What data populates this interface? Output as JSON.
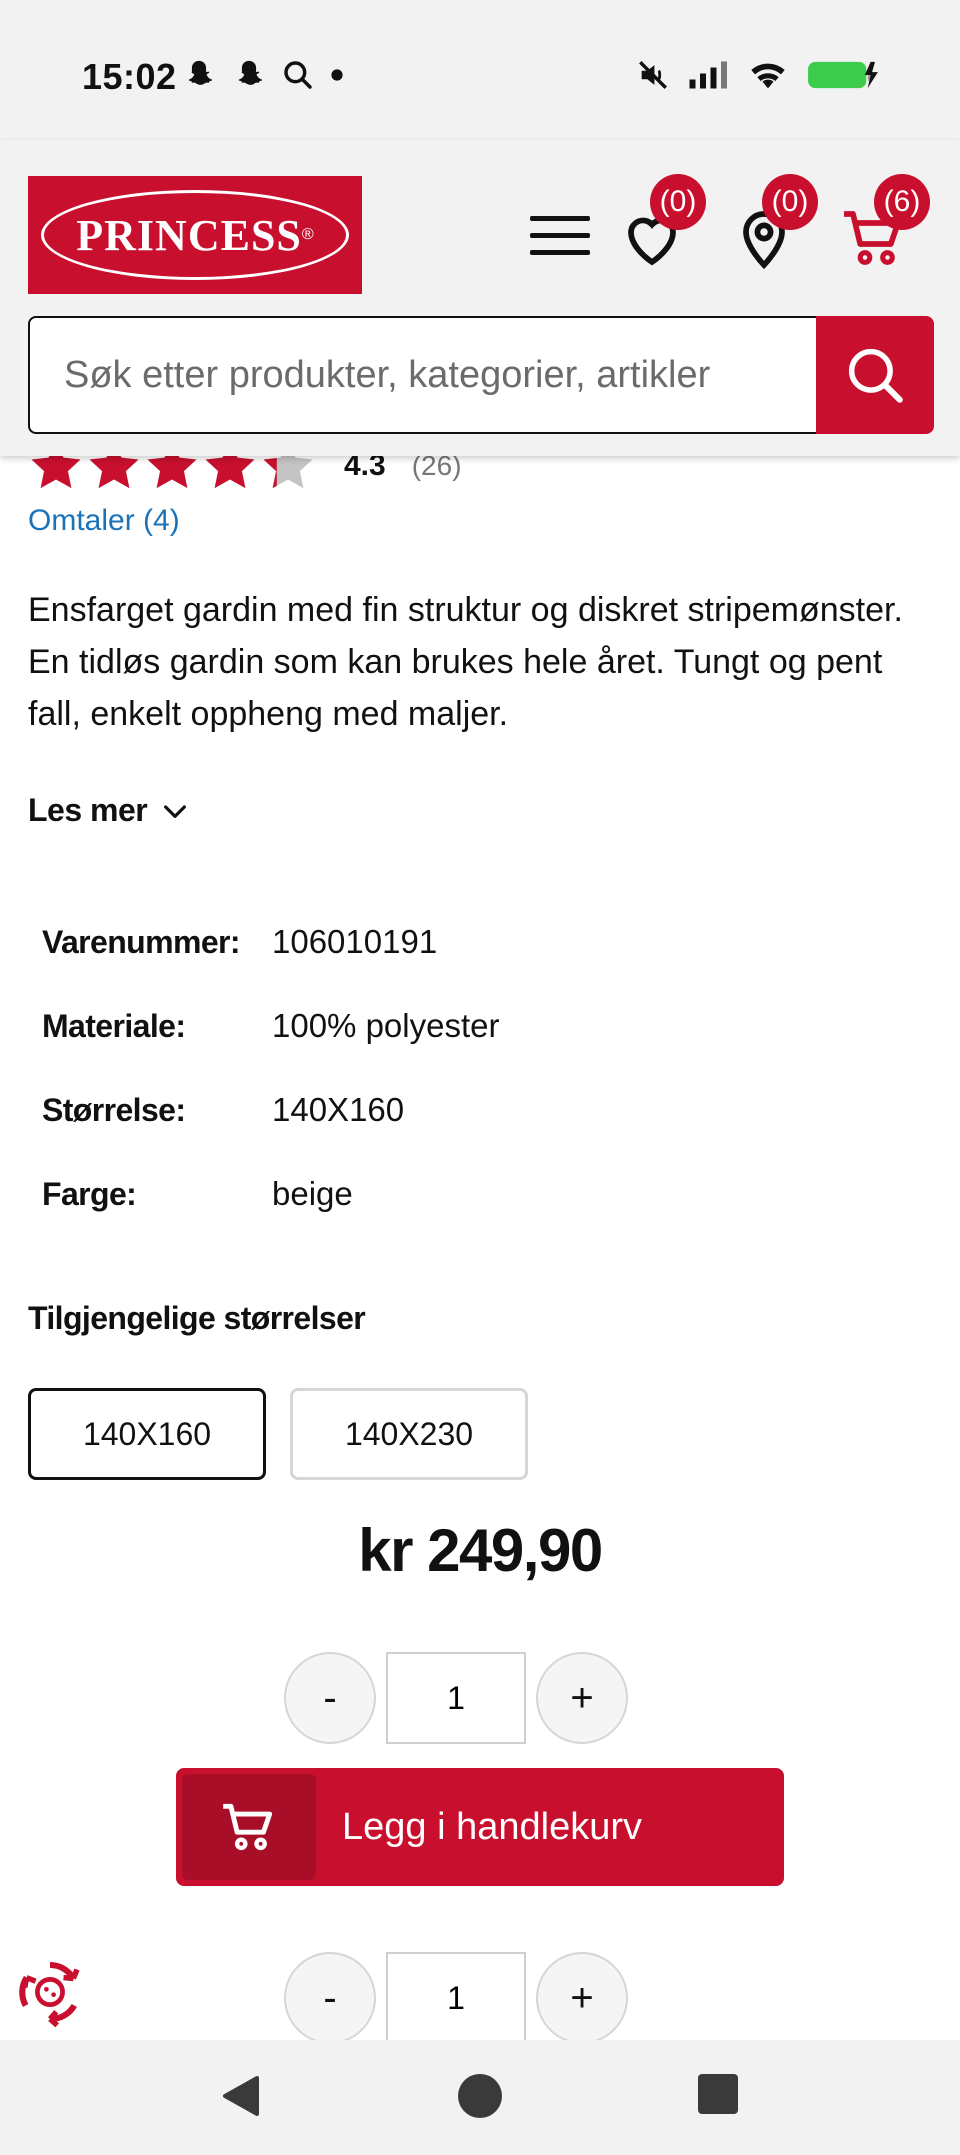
{
  "status_bar": {
    "time": "15:02"
  },
  "header": {
    "logo_text": "PRINCESS",
    "logo_registered": "®",
    "wishlist_count": "(0)",
    "stores_count": "(0)",
    "cart_count": "(6)"
  },
  "search": {
    "placeholder": "Søk etter produkter, kategorier, artikler"
  },
  "product": {
    "rating_value": "4.3",
    "rating_stars": 4.3,
    "rating_count": "(26)",
    "reviews_link": "Omtaler (4)",
    "description": "Ensfarget gardin med fin struktur og diskret stripemønster. En tidløs gardin som kan brukes hele året. Tungt og pent fall, enkelt oppheng med maljer.",
    "read_more": "Les mer",
    "specs": [
      {
        "key": "Varenummer:",
        "value": "106010191"
      },
      {
        "key": "Materiale:",
        "value": "100% polyester"
      },
      {
        "key": "Størrelse:",
        "value": "140X160"
      },
      {
        "key": "Farge:",
        "value": "beige"
      }
    ],
    "sizes_title": "Tilgjengelige størrelser",
    "sizes": [
      "140X160",
      "140X230"
    ],
    "selected_size": "140X160",
    "price": "kr 249,90",
    "quantity": "1",
    "qty_minus": "-",
    "qty_plus": "+",
    "add_to_cart": "Legg i handlekurv"
  },
  "colors": {
    "brand_red": "#c8102e",
    "link_blue": "#1a73b8"
  }
}
